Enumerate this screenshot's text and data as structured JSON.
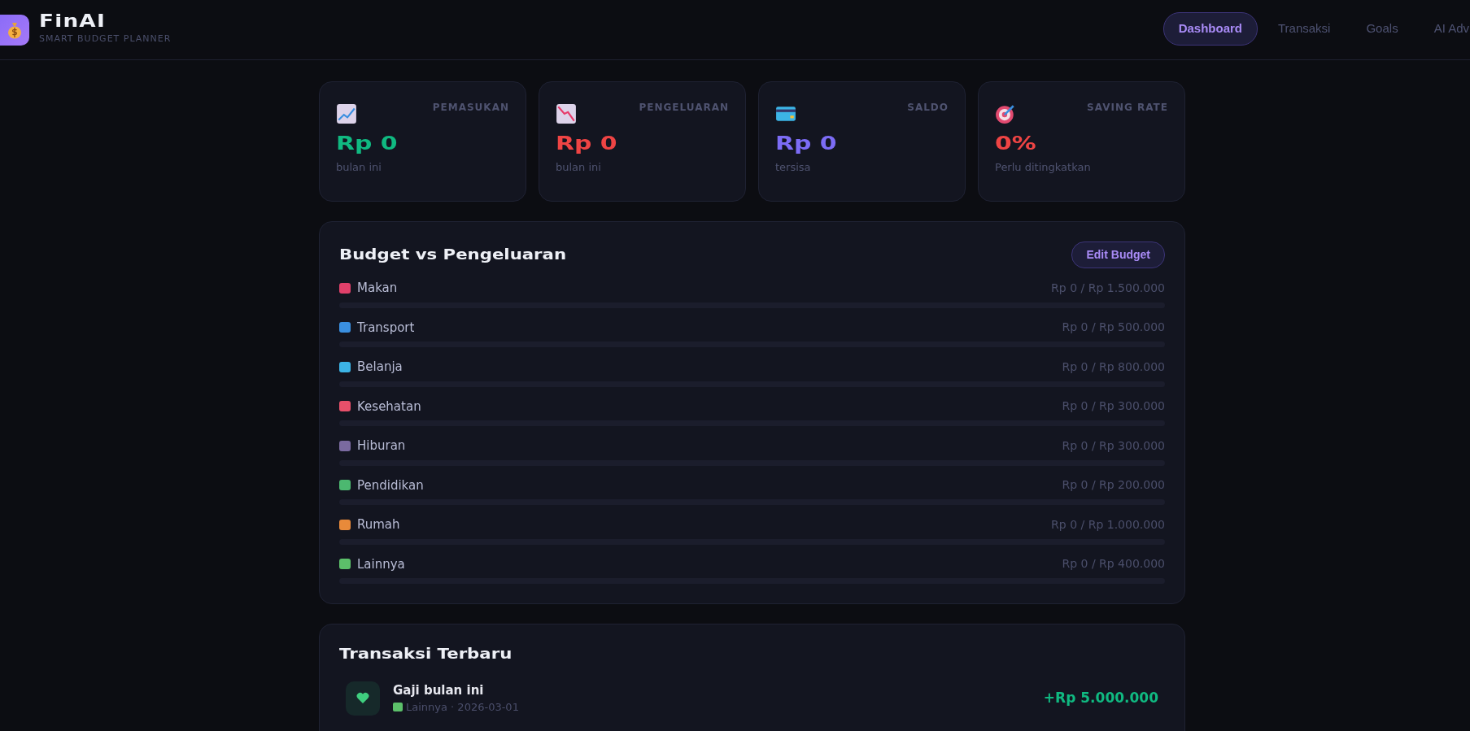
{
  "app": {
    "name": "FinAI",
    "tagline": "SMART BUDGET PLANNER"
  },
  "nav": [
    {
      "label": "Dashboard",
      "selected": true
    },
    {
      "label": "Transaksi",
      "selected": false
    },
    {
      "label": "Goals",
      "selected": false
    },
    {
      "label": "AI Adv",
      "selected": false
    }
  ],
  "stats": [
    {
      "kind": "up",
      "label": "PEMASUKAN",
      "value": "Rp 0",
      "note": "bulan ini",
      "color": "#10b981"
    },
    {
      "kind": "down",
      "label": "PENGELUARAN",
      "value": "Rp 0",
      "note": "bulan ini",
      "color": "#ef4444"
    },
    {
      "kind": "card",
      "label": "SALDO",
      "value": "Rp 0",
      "note": "tersisa",
      "color": "#7c6cf5"
    },
    {
      "kind": "target",
      "label": "SAVING RATE",
      "value": "0%",
      "note": "Perlu ditingkatkan",
      "color": "#ef4444"
    }
  ],
  "budget": {
    "title": "Budget vs Pengeluaran",
    "button": "Edit Budget",
    "items": [
      {
        "name": "Makan",
        "amount": "Rp 0 / Rp 1.500.000",
        "level": 0
      },
      {
        "name": "Transport",
        "amount": "Rp 0 / Rp 500.000",
        "level": 0
      },
      {
        "name": "Belanja",
        "amount": "Rp 0 / Rp 800.000",
        "level": 0
      },
      {
        "name": "Kesehatan",
        "amount": "Rp 0 / Rp 300.000",
        "level": 0
      },
      {
        "name": "Hiburan",
        "amount": "Rp 0 / Rp 300.000",
        "level": 0
      },
      {
        "name": "Pendidikan",
        "amount": "Rp 0 / Rp 200.000",
        "level": 0
      },
      {
        "name": "Rumah",
        "amount": "Rp 0 / Rp 1.000.000",
        "level": 0
      },
      {
        "name": "Lainnya",
        "amount": "Rp 0 / Rp 400.000",
        "level": 0
      }
    ]
  },
  "transactions": {
    "title": "Transaksi Terbaru",
    "items": [
      {
        "kind": "income",
        "name": "Gaji bulan ini",
        "meta": "Lainnya · 2026-03-01",
        "amount": "+Rp 5.000.000"
      }
    ]
  }
}
